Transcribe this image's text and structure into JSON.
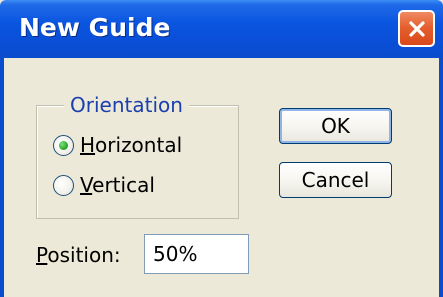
{
  "window": {
    "title": "New Guide",
    "close_icon": "close-icon"
  },
  "orientation": {
    "legend": "Orientation",
    "options": [
      {
        "label_first": "H",
        "label_rest": "orizontal",
        "selected": true
      },
      {
        "label_first": "V",
        "label_rest": "ertical",
        "selected": false
      }
    ]
  },
  "buttons": {
    "ok_label": "OK",
    "cancel_label": "Cancel"
  },
  "position": {
    "label_first": "P",
    "label_rest": "osition:",
    "value": "50%"
  },
  "colors": {
    "titlebar": "#0a55e0",
    "close_button": "#e5612f",
    "dialog_bg": "#ece9d8",
    "legend_text": "#1a3fae",
    "radio_selected": "#21a121"
  }
}
